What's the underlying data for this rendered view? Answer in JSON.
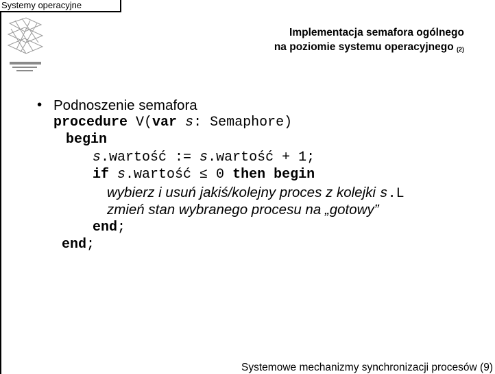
{
  "header": {
    "course": "Systemy operacyjne"
  },
  "slide": {
    "title_line1": "Implementacja semafora ogólnego",
    "title_line2": "na poziomie systemu operacyjnego",
    "title_number": "(2)"
  },
  "content": {
    "bullet": "Podnoszenie semafora",
    "code": {
      "l1_kw": "procedure",
      "l1_rest_a": " V(",
      "l1_kw2": "var",
      "l1_s": " s",
      "l1_rest_b": ": Semaphore)",
      "l2_kw": "begin",
      "l3_s1": "s",
      "l3_mid": ".wartość := ",
      "l3_s2": "s",
      "l3_end": ".wartość + 1;",
      "l4_kw": "if",
      "l4_s": " s",
      "l4_mid": ".wartość ≤ 0 ",
      "l4_kw2": "then begin",
      "l5_text": "wybierz i usuń jakiś/kolejny proces z kolejki ",
      "l5_s": "s",
      "l5_end": ".L",
      "l6_text": "zmień stan wybranego procesu na „gotowy”",
      "l7_kw": "end",
      "l7_end": ";",
      "l8_kw": "end",
      "l8_end": ";"
    }
  },
  "footer": {
    "text": "Systemowe mechanizmy synchronizacji procesów (9)"
  }
}
